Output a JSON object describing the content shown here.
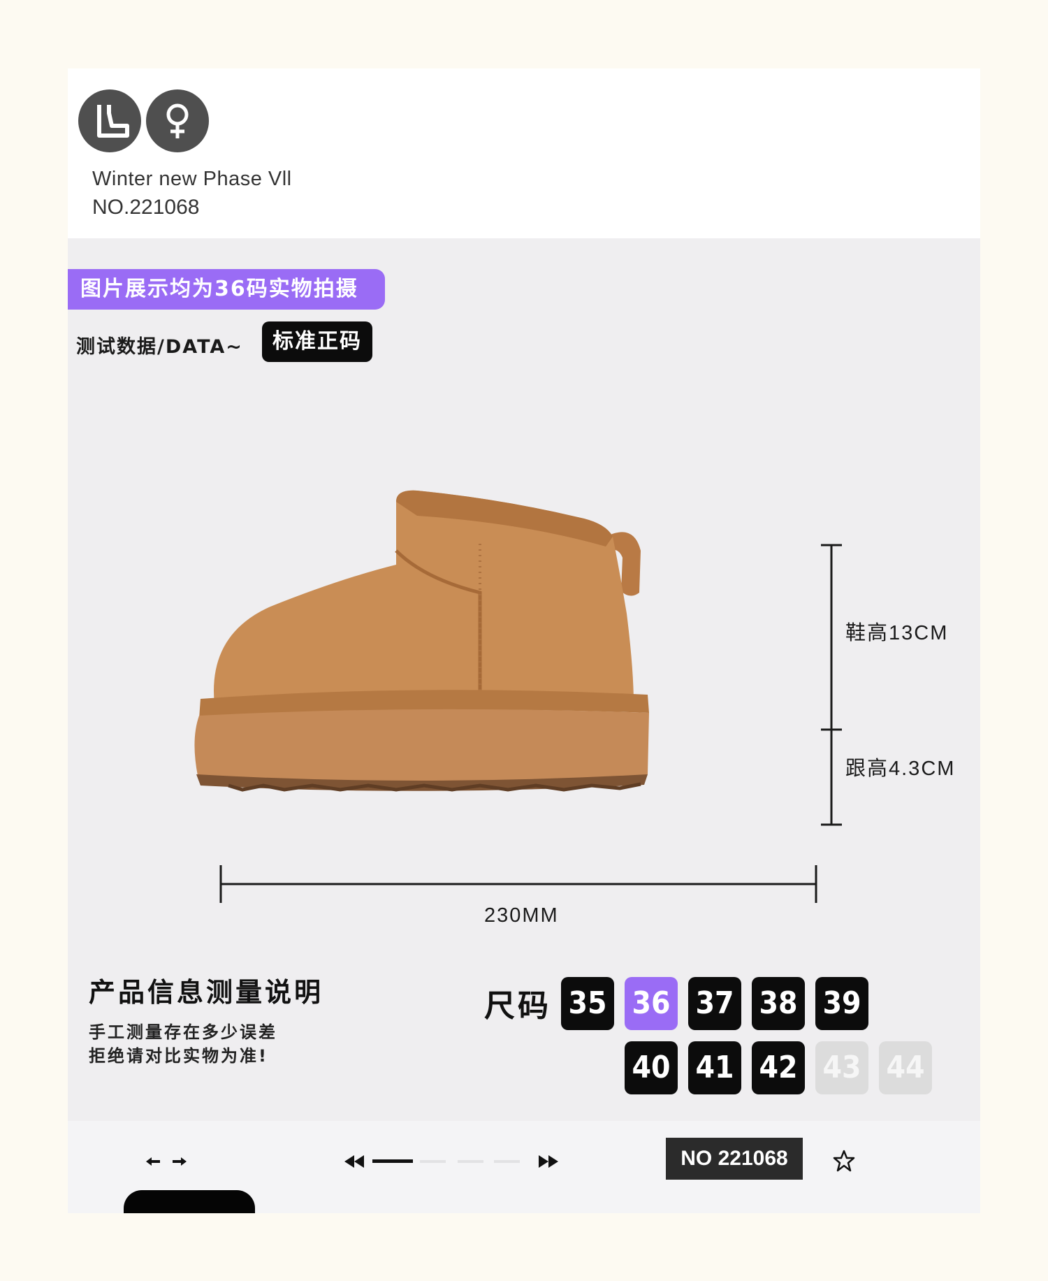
{
  "header": {
    "collection": "Winter new Phase Vll",
    "number": "NO.221068",
    "icons": [
      "boot-icon",
      "female-icon"
    ]
  },
  "banner": {
    "text": "图片展示均为36码实物拍摄"
  },
  "test": {
    "label": "测试数据/DATA~",
    "badge": "标准正码"
  },
  "dimensions": {
    "shoe_height": "鞋高13CM",
    "heel_height": "跟高4.3CM",
    "length": "230MM"
  },
  "info": {
    "title": "产品信息测量说明",
    "note_line1": "手工测量存在多少误差",
    "note_line2": "拒绝请对比实物为准!"
  },
  "sizes": {
    "label": "尺码",
    "items": [
      {
        "size": "35",
        "state": "available"
      },
      {
        "size": "36",
        "state": "selected"
      },
      {
        "size": "37",
        "state": "available"
      },
      {
        "size": "38",
        "state": "available"
      },
      {
        "size": "39",
        "state": "available"
      },
      {
        "size": "40",
        "state": "available"
      },
      {
        "size": "41",
        "state": "available"
      },
      {
        "size": "42",
        "state": "available"
      },
      {
        "size": "43",
        "state": "unavailable"
      },
      {
        "size": "44",
        "state": "unavailable"
      }
    ]
  },
  "bottom_bar": {
    "number_badge": "NO 221068",
    "progress_fraction": 0.25,
    "icons": [
      "arrow-left-icon",
      "arrow-right-icon",
      "rewind-icon",
      "fast-forward-icon",
      "star-icon"
    ]
  },
  "colors": {
    "accent_purple": "#9a6cf5",
    "tile_black": "#0c0c0c",
    "tile_disabled": "#dcdcdc",
    "boot_suede": "#c98d55"
  }
}
